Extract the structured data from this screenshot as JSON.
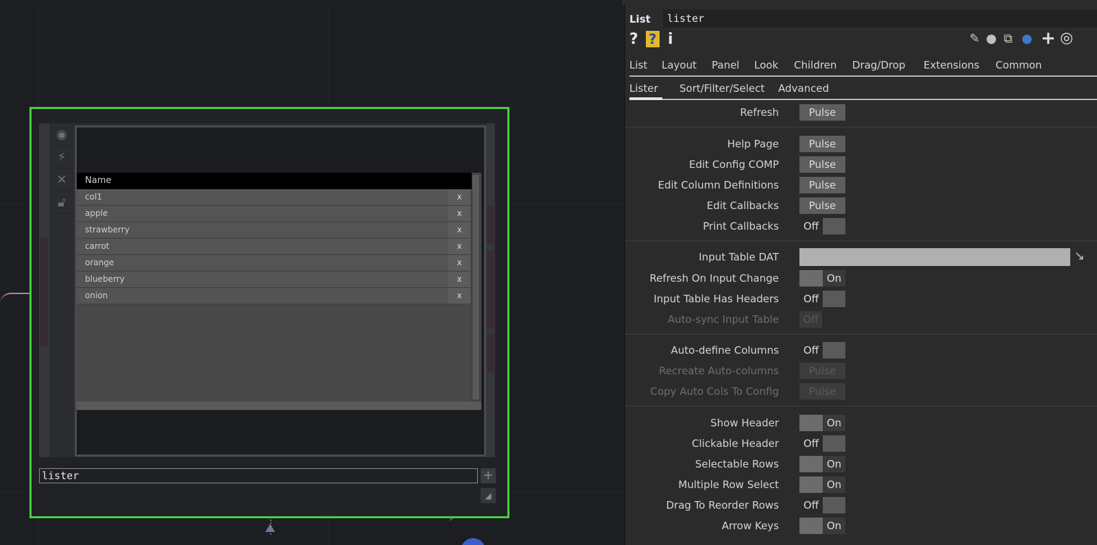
{
  "node": {
    "name": "lister",
    "columns": {
      "header": "Name"
    },
    "rows": [
      {
        "label": "col1",
        "remove": "x"
      },
      {
        "label": "apple",
        "remove": "x"
      },
      {
        "label": "strawberry",
        "remove": "x"
      },
      {
        "label": "carrot",
        "remove": "x"
      },
      {
        "label": "orange",
        "remove": "x"
      },
      {
        "label": "blueberry",
        "remove": "x"
      },
      {
        "label": "onion",
        "remove": "x"
      }
    ],
    "icons": [
      "viewer-icon",
      "graph-icon",
      "bypass-icon",
      "lock-icon"
    ],
    "border_color": "#47d13f"
  },
  "params": {
    "type": "List",
    "name": "lister",
    "tabs": [
      "List",
      "Layout",
      "Panel",
      "Look",
      "Children",
      "Drag/Drop",
      "Extensions",
      "Common"
    ],
    "subtabs": [
      "Lister",
      "Sort/Filter/Select",
      "Advanced"
    ],
    "rows": {
      "refresh": {
        "label": "Refresh",
        "value": "Pulse"
      },
      "help_page": {
        "label": "Help Page",
        "value": "Pulse"
      },
      "edit_config": {
        "label": "Edit Config COMP",
        "value": "Pulse"
      },
      "edit_cols": {
        "label": "Edit Column Definitions",
        "value": "Pulse"
      },
      "edit_callbacks": {
        "label": "Edit Callbacks",
        "value": "Pulse"
      },
      "print_callbacks": {
        "label": "Print Callbacks",
        "value": "Off"
      },
      "input_table": {
        "label": "Input Table DAT",
        "value": ""
      },
      "refresh_on_input": {
        "label": "Refresh On Input Change",
        "value": "On"
      },
      "input_headers": {
        "label": "Input Table Has Headers",
        "value": "Off"
      },
      "autosync": {
        "label": "Auto-sync Input Table",
        "value": "Off"
      },
      "auto_define": {
        "label": "Auto-define Columns",
        "value": "Off"
      },
      "recreate_auto": {
        "label": "Recreate Auto-columns",
        "value": "Pulse"
      },
      "copy_auto": {
        "label": "Copy Auto Cols To Config",
        "value": "Pulse"
      },
      "show_header": {
        "label": "Show Header",
        "value": "On"
      },
      "clickable_header": {
        "label": "Clickable Header",
        "value": "Off"
      },
      "selectable_rows": {
        "label": "Selectable Rows",
        "value": "On"
      },
      "multi_select": {
        "label": "Multiple Row Select",
        "value": "On"
      },
      "drag_reorder": {
        "label": "Drag To Reorder Rows",
        "value": "Off"
      },
      "arrow_keys": {
        "label": "Arrow Keys",
        "value": "On"
      }
    },
    "toolbar_left": [
      "help-icon",
      "python-help-icon",
      "info-icon"
    ],
    "toolbar_right": [
      "edit-icon",
      "comment-icon",
      "clone-icon",
      "python-icon",
      "add-icon",
      "target-icon"
    ],
    "glyphs": {
      "help": "?",
      "pyhelp": "?",
      "info": "i",
      "add": "+",
      "target": "◎",
      "pencil": "✎",
      "comment": "●",
      "clone": "⧉",
      "python": "●"
    }
  }
}
